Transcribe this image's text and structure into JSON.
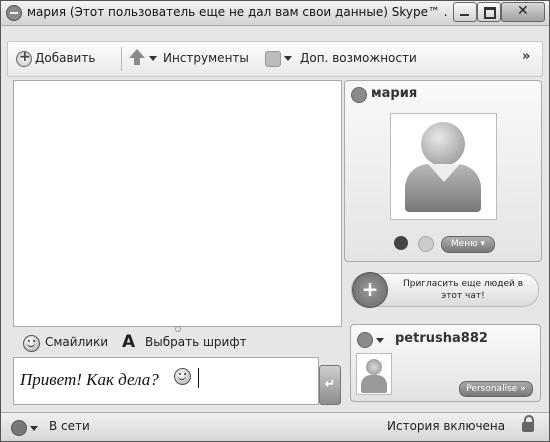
{
  "window": {
    "title": "мария (Этот пользователь еще не дал вам свои данные) Skype™ ..."
  },
  "toolbar": {
    "add_label": "Добавить",
    "tools_label": "Инструменты",
    "extras_label": "Доп. возможности",
    "more_label": "»"
  },
  "format_bar": {
    "smileys_label": "Смайлики",
    "font_label": "Выбрать шрифт",
    "font_glyph": "A"
  },
  "message_input": {
    "value": "Привет! Как дела?"
  },
  "send_button": {
    "glyph": "↵"
  },
  "contact": {
    "name": "мария",
    "menu_label": "Меню ▾"
  },
  "invite": {
    "label": "Пригласить еще людей в этот чат!"
  },
  "self_profile": {
    "name": "petrusha882",
    "personalise_label": "Personalise »"
  },
  "status_bar": {
    "status": "В сети",
    "history": "История включена"
  }
}
